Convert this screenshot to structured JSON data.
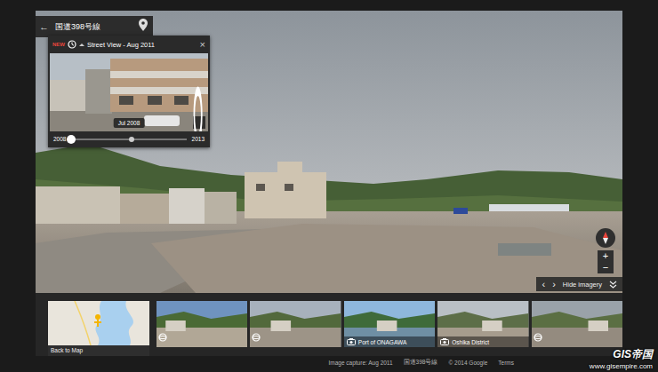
{
  "location_bar": {
    "back": "←",
    "title": "国道398号線"
  },
  "time_machine": {
    "badge": "NEW",
    "title": "Street View - Aug 2011",
    "close": "×",
    "photo_label": "Jul 2008",
    "start_year": "2008",
    "end_year": "2013",
    "level": 0.0,
    "marker_level": 0.52
  },
  "controls": {
    "zoom_in": "+",
    "zoom_out": "−",
    "prev": "‹",
    "next": "›",
    "hide_imagery": "Hide imagery"
  },
  "filmstrip": {
    "back_to_map": "Back to Map",
    "items": [
      {
        "kind": "panorama"
      },
      {
        "kind": "panorama"
      },
      {
        "kind": "photo",
        "caption": "Port of ONAGAWA"
      },
      {
        "kind": "photo",
        "caption": "Oshika District"
      },
      {
        "kind": "panorama"
      }
    ]
  },
  "footer": [
    "Image capture: Aug 2011",
    "国道398号線",
    "© 2014 Google",
    "Terms"
  ],
  "watermark": {
    "logo": "GIS帝国",
    "url": "www.gisempire.com"
  }
}
